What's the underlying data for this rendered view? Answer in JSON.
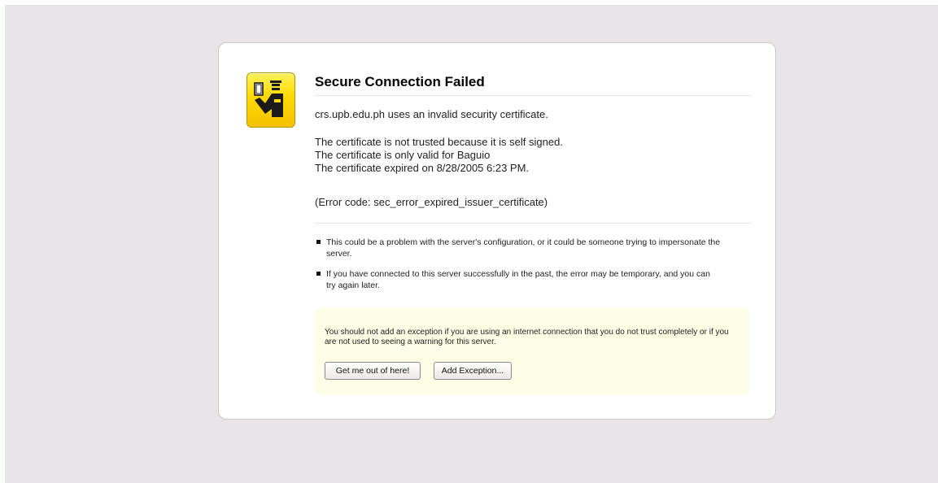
{
  "error_page": {
    "title": "Secure Connection Failed",
    "host_message": "crs.upb.edu.ph uses an invalid security certificate.",
    "details": [
      "The certificate is not trusted because it is self signed.",
      "The certificate is only valid for Baguio",
      "The certificate expired on 8/28/2005 6:23 PM."
    ],
    "error_code": "(Error code: sec_error_expired_issuer_certificate)",
    "bullets": [
      "This could be a problem with the server's configuration, or it could be someone trying to impersonate the server.",
      "If you have connected to this server successfully in the past, the error may be temporary, and you can try again later."
    ],
    "warning": "You should not add an exception if you are using an internet connection that you do not trust completely or if you are not used to seeing a warning for this server.",
    "buttons": {
      "get_out_label": "Get me out of here!",
      "add_exception_label": "Add Exception..."
    },
    "icon": "security-officer-icon"
  },
  "colors": {
    "background": "#e8e4e8",
    "icon_yellow": "#ffd800",
    "warning_panel": "#fefde6"
  }
}
